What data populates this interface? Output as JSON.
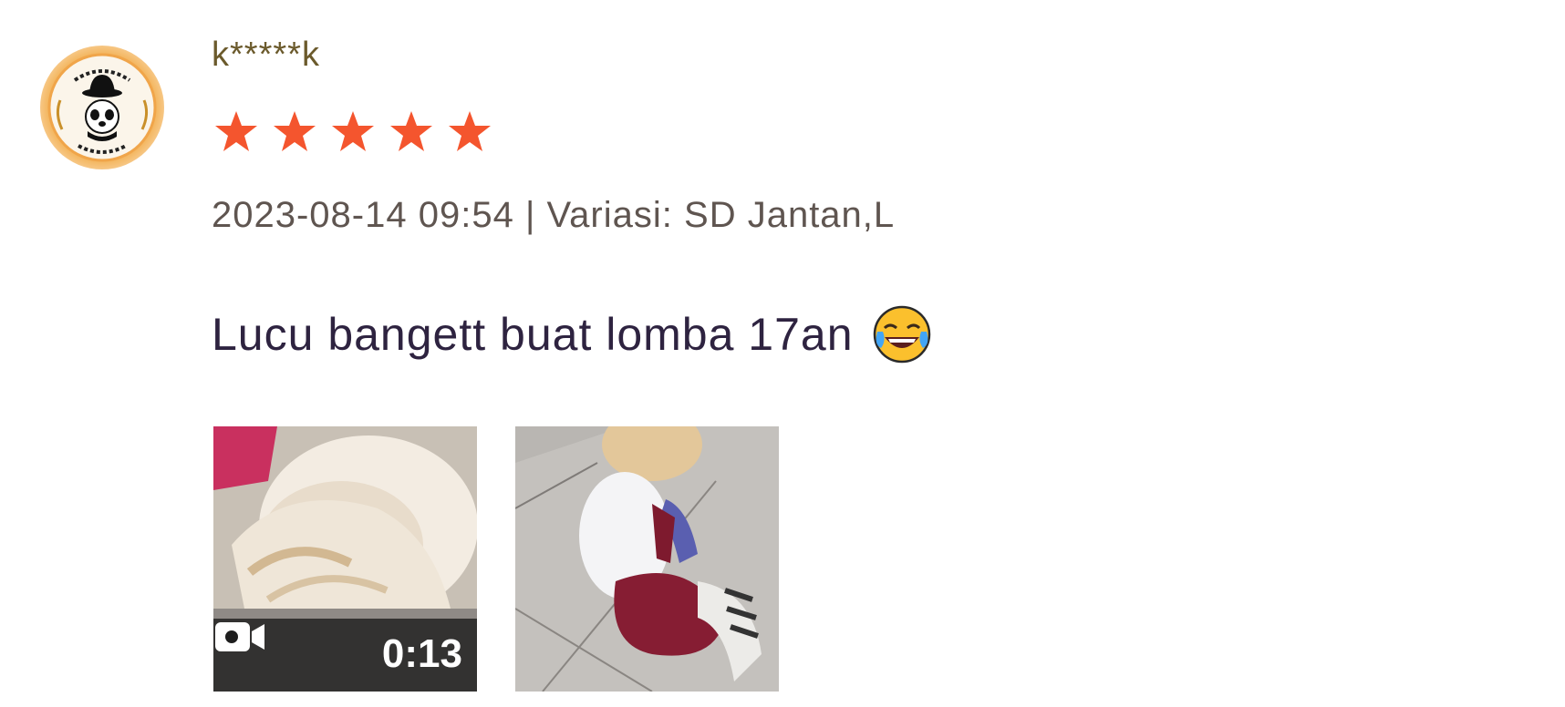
{
  "review": {
    "username": "k*****k",
    "rating": 5,
    "rating_max": 5,
    "star_color": "#f4552e",
    "timestamp": "2023-08-14 09:54",
    "separator": "|",
    "variation_label": "Variasi:",
    "variation_value": "SD Jantan,L",
    "comment": "Lucu bangett buat lomba 17an",
    "comment_emoji": "face-with-tears-of-joy-icon",
    "media": [
      {
        "type": "video",
        "duration": "0:13",
        "icon": "video-camera-icon"
      },
      {
        "type": "photo"
      }
    ]
  }
}
